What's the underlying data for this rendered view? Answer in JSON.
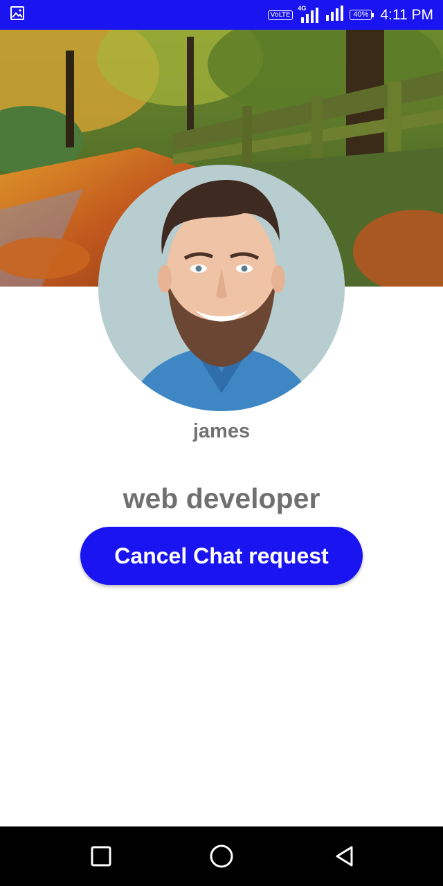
{
  "status_bar": {
    "volte_label": "VoLTE",
    "network_type": "4G",
    "battery": "40%",
    "time": "4:11 PM",
    "icons": [
      "image-icon",
      "signal-icon",
      "battery-icon"
    ]
  },
  "profile": {
    "name": "james",
    "status": "web developer"
  },
  "actions": {
    "cancel_label": "Cancel Chat request"
  },
  "nav_bar": {
    "icons": [
      "recents-icon",
      "home-icon",
      "back-icon"
    ]
  },
  "colors": {
    "accent": "#1a14f0",
    "text_gray": "#727272"
  }
}
